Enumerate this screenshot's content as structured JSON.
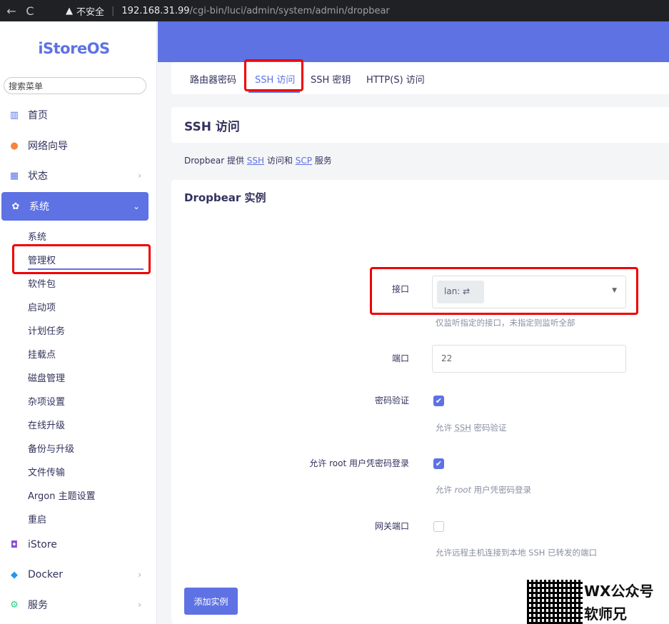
{
  "browser": {
    "back": "←",
    "reload": "C",
    "warning": "不安全",
    "url_host": "192.168.31.99",
    "url_path": "/cgi-bin/luci/admin/system/admin/dropbear"
  },
  "sidebar": {
    "logo": "iStoreOS",
    "search_placeholder": "搜索菜单",
    "items": [
      {
        "label": "首页",
        "icon": "chart-icon"
      },
      {
        "label": "网络向导",
        "icon": "map-pin-icon"
      },
      {
        "label": "状态",
        "icon": "dashboard-icon"
      },
      {
        "label": "系统",
        "icon": "gear-icon"
      },
      {
        "label": "iStore",
        "icon": "bag-icon"
      },
      {
        "label": "Docker",
        "icon": "docker-icon"
      },
      {
        "label": "服务",
        "icon": "cogs-icon"
      }
    ],
    "sub_items": [
      "系统",
      "管理权",
      "软件包",
      "启动项",
      "计划任务",
      "挂载点",
      "磁盘管理",
      "杂项设置",
      "在线升级",
      "备份与升级",
      "文件传输",
      "Argon 主题设置",
      "重启"
    ]
  },
  "tabs": [
    "路由器密码",
    "SSH 访问",
    "SSH 密钥",
    "HTTP(S) 访问"
  ],
  "page_title": "SSH 访问",
  "description": {
    "prefix": "Dropbear 提供 ",
    "ssh": "SSH",
    "middle": " 访问和 ",
    "scp": "SCP",
    "suffix": " 服务"
  },
  "section": {
    "title": "Dropbear 实例",
    "interface_label": "接口",
    "interface_value": "lan: ",
    "interface_desc": "仅监听指定的接口，未指定则监听全部",
    "port_label": "端口",
    "port_value": "22",
    "password_auth_label": "密码验证",
    "password_auth_desc_prefix": "允许 ",
    "password_auth_desc_ssh": "SSH",
    "password_auth_desc_suffix": " 密码验证",
    "root_login_label": "允许 root 用户凭密码登录",
    "root_login_desc_prefix": "允许 ",
    "root_login_desc_root": "root",
    "root_login_desc_suffix": " 用户凭密码登录",
    "gateway_label": "网关端口",
    "gateway_desc": "允许远程主机连接到本地 SSH 已转发的端口",
    "add_button": "添加实例"
  },
  "checkboxes": {
    "password_auth": true,
    "root_login": true,
    "gateway_ports": false
  },
  "watermark": {
    "line1": "WX公众号",
    "line2": "软师兄"
  },
  "colors": {
    "accent": "#5e72e4",
    "highlight": "#e00000"
  }
}
